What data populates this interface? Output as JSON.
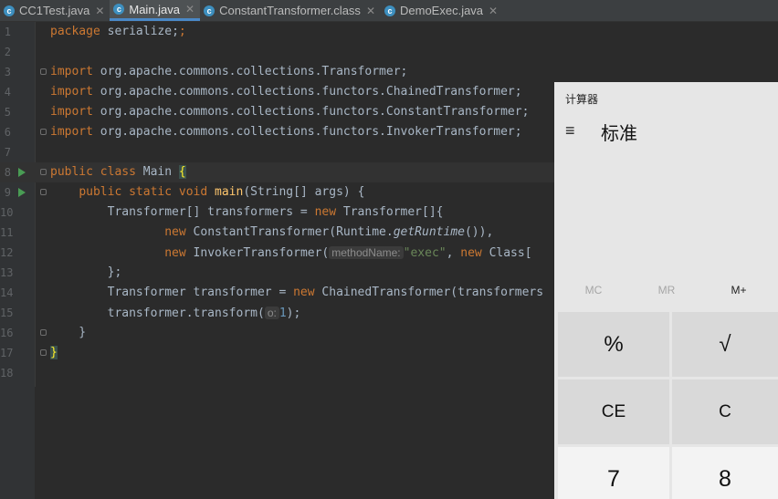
{
  "tabs": [
    {
      "label": "CC1Test.java",
      "icon": "c-icon",
      "active": false
    },
    {
      "label": "Main.java",
      "icon": "c-icon",
      "active": true
    },
    {
      "label": "ConstantTransformer.class",
      "icon": "c-icon",
      "active": false
    },
    {
      "label": "DemoExec.java",
      "icon": "c-icon",
      "active": false
    }
  ],
  "close_glyph": "✕",
  "class_glyph": "c",
  "editor": {
    "line_numbers": [
      "1",
      "2",
      "3",
      "4",
      "5",
      "6",
      "7",
      "8",
      "9",
      "10",
      "11",
      "12",
      "13",
      "14",
      "15",
      "16",
      "17",
      "18"
    ],
    "code": {
      "l1_kw": "package",
      "l1_rest": " serialize;",
      "import_kw": "import",
      "l3_rest": " org.apache.commons.collections.Transformer;",
      "l4_rest": " org.apache.commons.collections.functors.ChainedTransformer;",
      "l5_rest": " org.apache.commons.collections.functors.ConstantTransformer;",
      "l6_rest": " org.apache.commons.collections.functors.InvokerTransformer;",
      "l8_kw": "public class",
      "l8_name": " Main ",
      "l8_brace": "{",
      "l9_indent": "    ",
      "l9_kw": "public static void",
      "l9_fn": "main",
      "l9_rest": "(String[] args) {",
      "l10_a": "        Transformer[] transformers = ",
      "new_kw": "new",
      "l10_b": " Transformer[]{",
      "l11_indent": "                ",
      "l11_b": " ConstantTransformer(Runtime.",
      "l11_it": "getRuntime",
      "l11_c": "()),",
      "l12_indent": "                ",
      "l12_b": " InvokerTransformer(",
      "l12_hint": "methodName:",
      "l12_str": "\"exec\"",
      "l12_c": ", ",
      "l12_d": " Class[",
      "l13": "        };",
      "l14_a": "        Transformer transformer = ",
      "l14_b": " ChainedTransformer(transformers",
      "l15_a": "        transformer.transform(",
      "l15_hint": "o:",
      "l15_num": "1",
      "l15_c": ");",
      "l16": "    }",
      "l17_brace": "}"
    }
  },
  "calculator": {
    "title": "计算器",
    "menu_icon": "≡",
    "mode": "标准",
    "memory": [
      "MC",
      "MR",
      "M+"
    ],
    "keys": [
      "%",
      "√",
      "CE",
      "C",
      "7",
      "8"
    ]
  },
  "colors": {
    "editor_bg": "#2b2b2b",
    "keyword": "#cc7832",
    "function": "#ffc66d",
    "string": "#6a8759",
    "number": "#6897bb",
    "run_icon": "#499c54",
    "calc_bg": "#e6e6e6"
  }
}
